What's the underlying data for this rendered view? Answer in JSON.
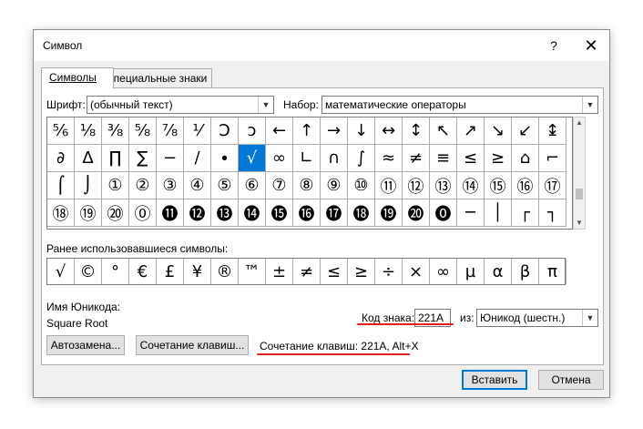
{
  "dialog": {
    "title": "Символ",
    "help_label": "?",
    "close_label": "✕",
    "tabs": [
      {
        "label": "Символы"
      },
      {
        "label": "Специальные знаки"
      }
    ],
    "font_label": "Шрифт:",
    "font_value": "(обычный текст)",
    "subset_label": "Набор:",
    "subset_value": "математические операторы",
    "symbols": [
      [
        "⅚",
        "⅛",
        "⅜",
        "⅝",
        "⅞",
        "⅟",
        "Ↄ",
        "ↄ",
        "←",
        "↑",
        "→",
        "↓",
        "↔",
        "↕",
        "↖",
        "↗",
        "↘",
        "↙",
        "↨"
      ],
      [
        "∂",
        "∆",
        "∏",
        "∑",
        "−",
        "∕",
        "∙",
        "√",
        "∞",
        "∟",
        "∩",
        "∫",
        "≈",
        "≠",
        "≡",
        "≤",
        "≥",
        "⌂",
        "⌐"
      ],
      [
        "⌠",
        "⌡",
        "①",
        "②",
        "③",
        "④",
        "⑤",
        "⑥",
        "⑦",
        "⑧",
        "⑨",
        "⑩",
        "⑪",
        "⑫",
        "⑬",
        "⑭",
        "⑮",
        "⑯",
        "⑰"
      ],
      [
        "⑱",
        "⑲",
        "⑳",
        "⓪",
        "⓫",
        "⓬",
        "⓭",
        "⓮",
        "⓯",
        "⓰",
        "⓱",
        "⓲",
        "⓳",
        "⓴",
        "⓿",
        "─",
        "│",
        "┌",
        "┐"
      ]
    ],
    "selected_symbol": "√",
    "recent_label": "Ранее использовавшиеся символы:",
    "recent_symbols": [
      "√",
      "©",
      "°",
      "€",
      "£",
      "¥",
      "®",
      "™",
      "±",
      "≠",
      "≤",
      "≥",
      "÷",
      "×",
      "∞",
      "µ",
      "α",
      "β",
      "π"
    ],
    "unicode_name_label": "Имя Юникода:",
    "unicode_name_value": "Square Root",
    "char_code_label": "Код знака:",
    "char_code_value": "221A",
    "from_label": "из:",
    "from_value": "Юникод (шестн.)",
    "autocorrect_button": "Автозамена...",
    "shortcut_key_button": "Сочетание клавиш...",
    "shortcut_text": "Сочетание клавиш: 221A, Alt+X",
    "insert_button": "Вставить",
    "cancel_button": "Отмена"
  },
  "colors": {
    "selection": "#0078d7",
    "annotation_underline": "#e02020",
    "dialog_background": "#f0f0f0"
  }
}
